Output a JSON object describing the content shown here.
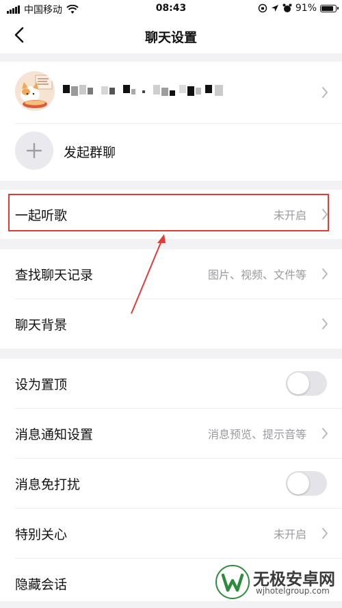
{
  "status_bar": {
    "carrier": "中国移动",
    "time": "08:43",
    "battery": "91%",
    "battery_level": 0.91
  },
  "nav": {
    "title": "聊天设置",
    "back_icon": "chevron-left-icon"
  },
  "profile": {
    "avatar_icon": "cat-avatar-icon",
    "name_icon": "pixelated-name-icon"
  },
  "group_chat": {
    "label": "发起群聊",
    "icon": "plus-icon"
  },
  "listen_together": {
    "label": "一起听歌",
    "value": "未开启"
  },
  "history": {
    "search_label": "查找聊天记录",
    "search_value": "图片、视频、文件等",
    "background_label": "聊天背景"
  },
  "settings": {
    "pin_label": "设为置顶",
    "pin_on": false,
    "notify_label": "消息通知设置",
    "notify_value": "消息预览、提示音等",
    "dnd_label": "消息免打扰",
    "dnd_on": false,
    "special_label": "特别关心",
    "special_value": "未开启",
    "hide_label": "隐藏会话"
  },
  "annotation": {
    "highlight_color": "#e23a36"
  },
  "watermark": {
    "text": "无极安卓网",
    "url": "wjhotelgroup.com",
    "logo_icon": "w-logo-icon"
  }
}
